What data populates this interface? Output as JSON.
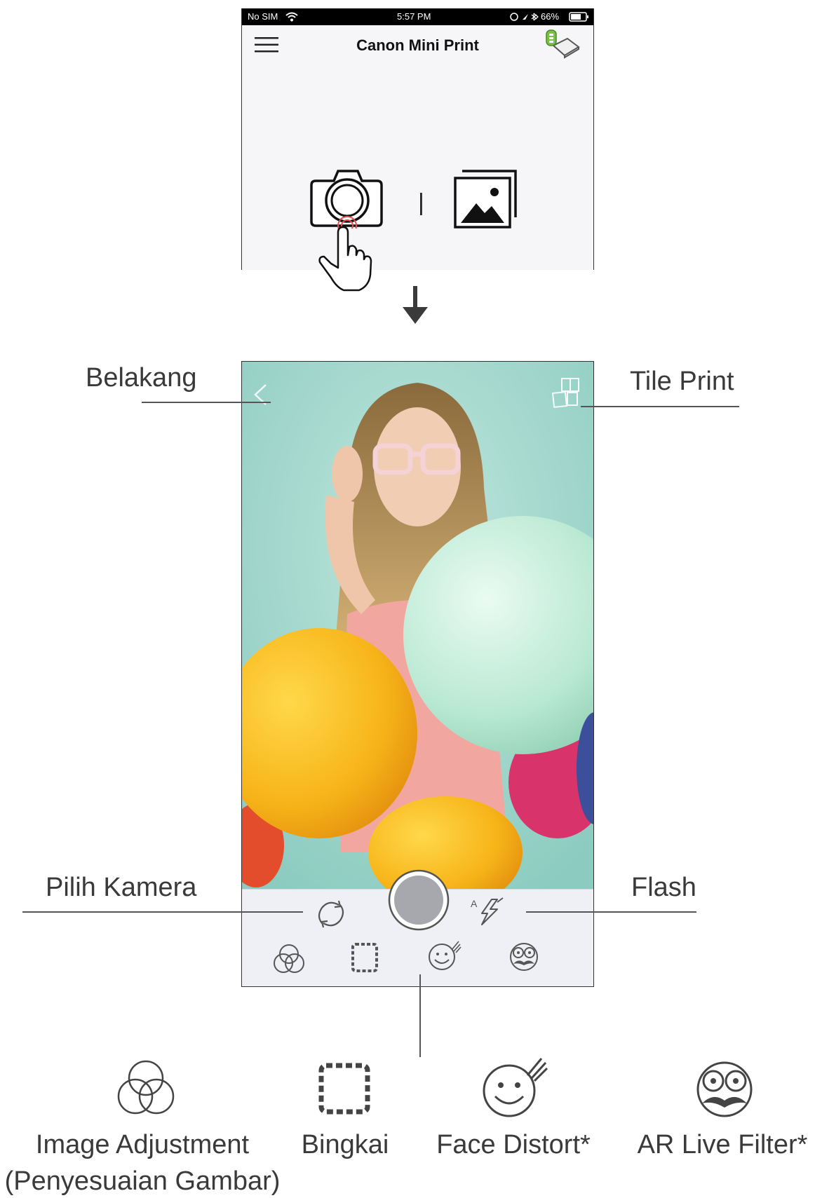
{
  "status_bar": {
    "carrier": "No SIM",
    "time": "5:57 PM",
    "battery": "66%"
  },
  "header": {
    "title": "Canon Mini Print",
    "menu_icon": "hamburger-icon",
    "printer_icon": "printer-battery-icon"
  },
  "home": {
    "camera_icon": "camera-icon",
    "gallery_icon": "gallery-icon",
    "separator": "|"
  },
  "callouts": {
    "back": "Belakang",
    "tile_print": "Tile Print",
    "switch_camera": "Pilih Kamera",
    "flash": "Flash"
  },
  "camera_toolbar": {
    "flash_label": "A",
    "icons": [
      "switch-camera-icon",
      "shutter-button",
      "flash-icon",
      "image-adjustment-icon",
      "frame-icon",
      "face-distort-icon",
      "ar-live-filter-icon"
    ]
  },
  "legend": [
    {
      "label": "Image Adjustment",
      "sub": "(Penyesuaian Gambar)"
    },
    {
      "label": "Bingkai"
    },
    {
      "label": "Face Distort*"
    },
    {
      "label": "AR Live Filter*"
    }
  ]
}
